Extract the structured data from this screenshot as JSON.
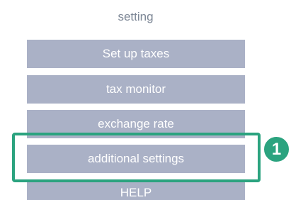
{
  "menu": {
    "title": "setting",
    "items": [
      {
        "label": "Set up taxes"
      },
      {
        "label": "tax monitor"
      },
      {
        "label": "exchange rate"
      },
      {
        "label": "additional settings"
      },
      {
        "label": "HELP"
      }
    ]
  },
  "annotation": {
    "step_number": "1",
    "highlight_color": "#2ba37f"
  },
  "colors": {
    "menu_item_bg": "#aab1c6",
    "menu_item_text": "#ffffff",
    "title_text": "#7d8796"
  }
}
